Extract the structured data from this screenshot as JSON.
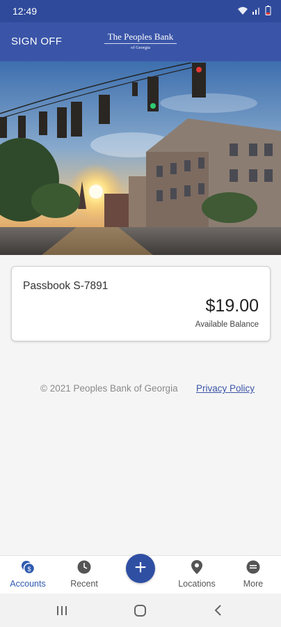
{
  "status_bar": {
    "time": "12:49"
  },
  "app_bar": {
    "sign_off_label": "SIGN OFF",
    "brand_name": "The Peoples Bank",
    "brand_sub": "of Georgia"
  },
  "account": {
    "name": "Passbook S-7891",
    "balance": "$19.00",
    "balance_label": "Available Balance"
  },
  "footer": {
    "copyright": "© 2021 Peoples Bank of Georgia",
    "privacy_link": "Privacy Policy"
  },
  "bottom_nav": {
    "items": [
      {
        "label": "Accounts",
        "icon": "accounts-icon",
        "active": true
      },
      {
        "label": "Recent",
        "icon": "clock-icon"
      },
      {
        "label": "Locations",
        "icon": "location-pin-icon"
      },
      {
        "label": "More",
        "icon": "more-icon"
      }
    ],
    "fab_icon": "plus-icon"
  },
  "colors": {
    "primary": "#3a55a8",
    "status_bar": "#2f4a9a",
    "active_nav": "#2f5ab0"
  }
}
